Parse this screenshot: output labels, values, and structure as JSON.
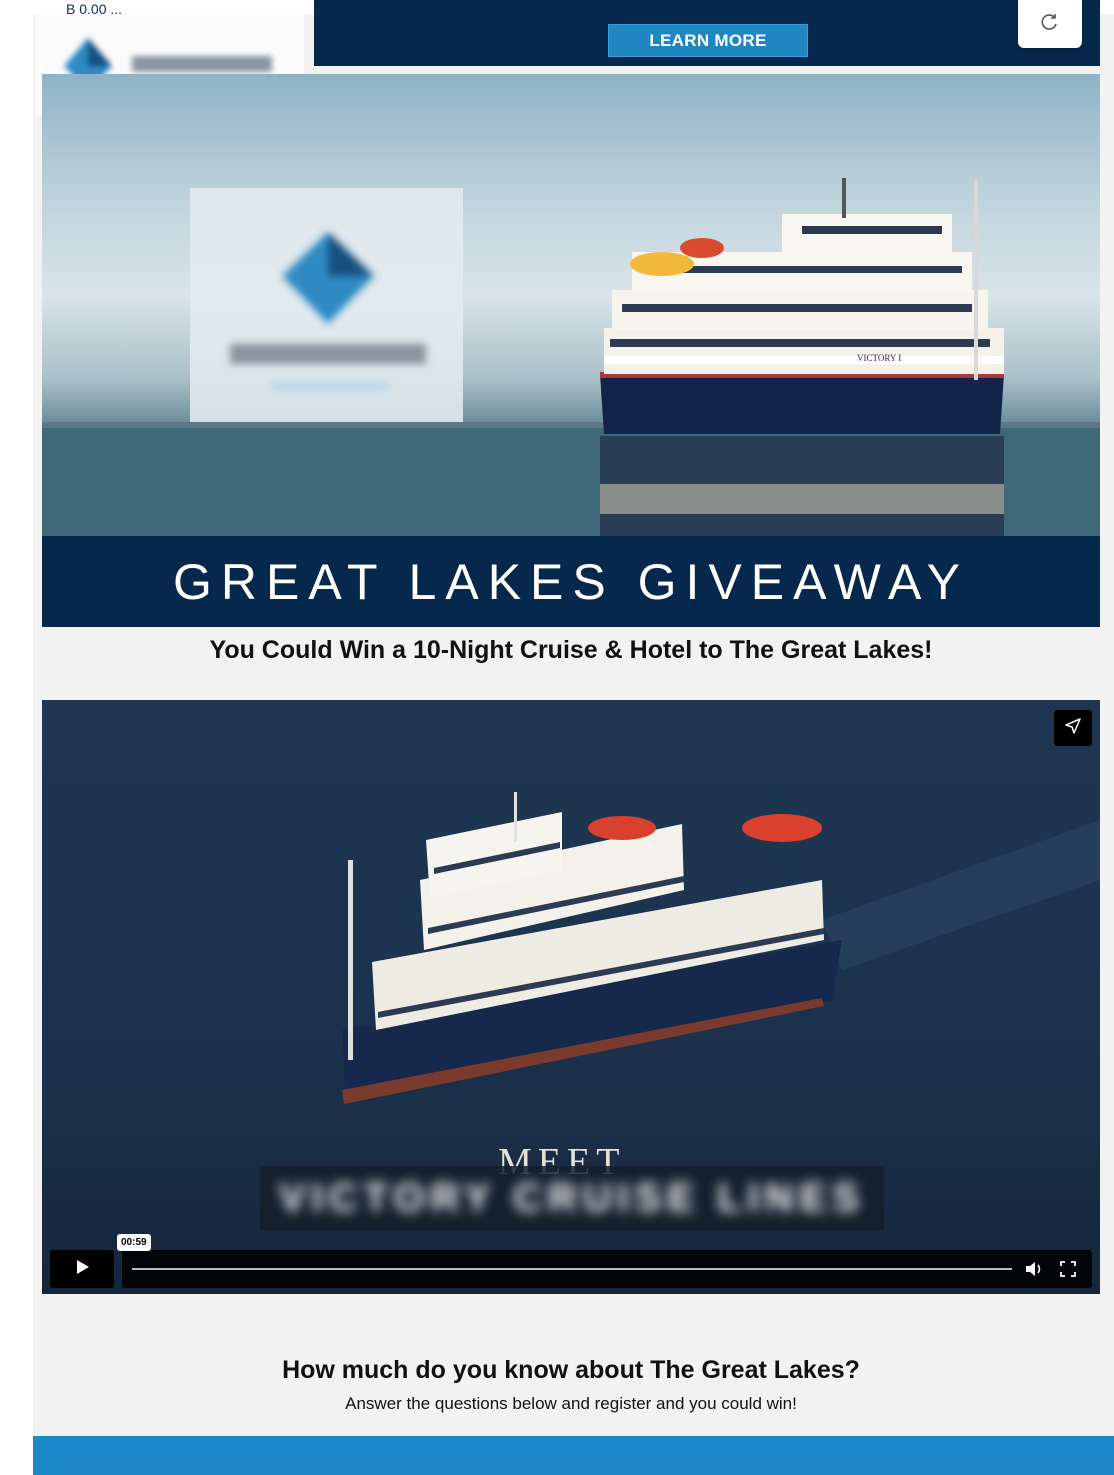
{
  "header": {
    "cut_off_text": "B 0.00 ...",
    "learn_more_label": "LEARN MORE"
  },
  "hero": {
    "title": "GREAT LAKES GIVEAWAY",
    "subtitle": "You Could Win a 10-Night Cruise & Hotel to The Great Lakes!",
    "ship_name": "VICTORY I"
  },
  "video": {
    "overlay_text": "MEET",
    "time": "00:59",
    "progress": 0.0
  },
  "quiz": {
    "heading": "How much do you know about The Great Lakes?",
    "subheading": "Answer the questions below and register and you could win!"
  },
  "colors": {
    "navy": "#06284c",
    "accent_blue": "#1f86c1",
    "footer_blue": "#1c89c8"
  },
  "icons": {
    "refresh": "refresh-icon",
    "share": "send-icon",
    "play": "play-icon",
    "volume": "volume-icon",
    "fullscreen": "fullscreen-icon"
  }
}
